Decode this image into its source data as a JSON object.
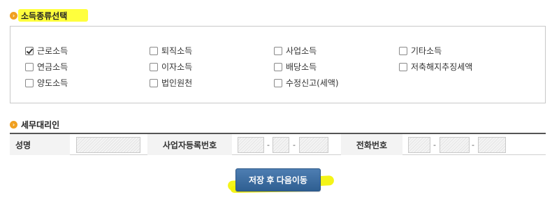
{
  "income_section": {
    "title": "소득종류선택",
    "options": [
      {
        "label": "근로소득",
        "checked": true
      },
      {
        "label": "퇴직소득",
        "checked": false
      },
      {
        "label": "사업소득",
        "checked": false
      },
      {
        "label": "기타소득",
        "checked": false
      },
      {
        "label": "연금소득",
        "checked": false
      },
      {
        "label": "이자소득",
        "checked": false
      },
      {
        "label": "배당소득",
        "checked": false
      },
      {
        "label": "저축해지추징세액",
        "checked": false
      },
      {
        "label": "양도소득",
        "checked": false
      },
      {
        "label": "법인원천",
        "checked": false
      },
      {
        "label": "수정신고(세액)",
        "checked": false
      }
    ]
  },
  "agent_section": {
    "title": "세무대리인",
    "name_label": "성명",
    "name_value": "",
    "biz_no_label": "사업자등록번호",
    "biz_no_parts": [
      "",
      "",
      ""
    ],
    "phone_label": "전화번호",
    "phone_parts": [
      "",
      "",
      ""
    ],
    "separator": "-"
  },
  "actions": {
    "save_next_label": "저장 후 다음이동"
  },
  "colors": {
    "highlight": "#ffff33",
    "button_bg": "#3d6ea3",
    "bullet": "#f0a020"
  }
}
